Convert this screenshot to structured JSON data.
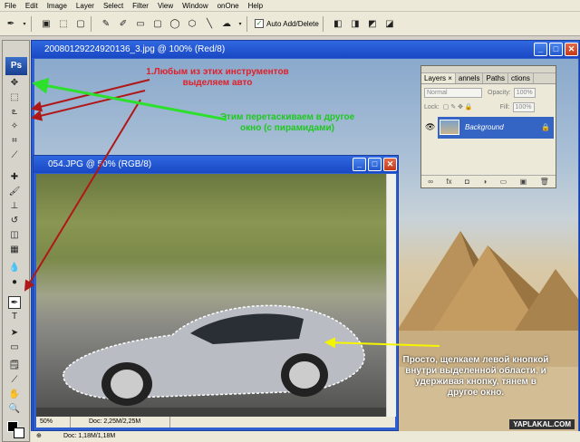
{
  "menu": [
    "File",
    "Edit",
    "Image",
    "Layer",
    "Select",
    "Filter",
    "View",
    "Window",
    "onOne",
    "Help"
  ],
  "options_bar": {
    "auto_add_delete_label": "Auto Add/Delete"
  },
  "toolbox": {
    "logo": "Ps"
  },
  "main_window": {
    "title": "20080129224920136_3.jpg @ 100% (Red/8)"
  },
  "layers_palette": {
    "tabs": [
      "Layers",
      "Channels",
      "Paths",
      "Actions"
    ],
    "tabs_visible": [
      "Layers ×",
      "annels",
      "Paths",
      "ctions"
    ],
    "blend_mode": "Normal",
    "opacity_label": "Opacity:",
    "opacity_value": "100%",
    "lock_label": "Lock:",
    "fill_label": "Fill:",
    "fill_value": "100%",
    "layer_name": "Background"
  },
  "car_window": {
    "title": "054.JPG @ 50% (RGB/8)",
    "zoom": "50%",
    "doc_size": "Doc: 2,25M/2,25M"
  },
  "bottom_status": {
    "doc_size": "Doc: 1,18M/1,18M"
  },
  "annotations": {
    "red_note": "1.Любым из этих инструментов выделяем авто",
    "green_note": "Этим перетаскиваем в другое окно (с пирамидами)",
    "white_note": "Просто, щелкаем левой кнопкой внутри выделенной области, и удерживая кнопку, тянем в другое окно."
  },
  "watermark": "YAPLAKAL.COM",
  "colors": {
    "titlebar": "#2f68e0",
    "red_arrow": "#b01818",
    "green_arrow": "#2ee02e",
    "yellow_arrow": "#f5f500"
  }
}
